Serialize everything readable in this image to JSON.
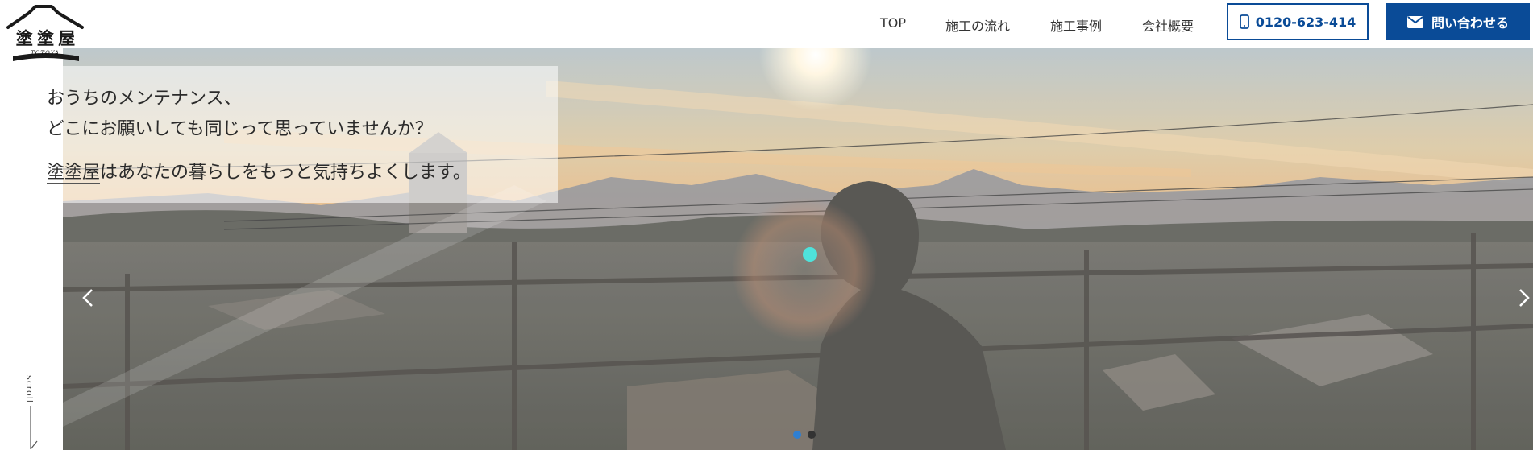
{
  "logo": {
    "text": "塗 塗 屋",
    "sub": "TOTOYA"
  },
  "nav": {
    "items": [
      {
        "label": "TOP"
      },
      {
        "label": "施工の流れ"
      },
      {
        "label": "施工事例"
      },
      {
        "label": "会社概要"
      }
    ],
    "phone_label": "0120-623-414",
    "contact_label": "問い合わせる"
  },
  "hero": {
    "line1": "おうちのメンテナンス、",
    "line2": "どこにお願いしても同じって思っていませんか？",
    "line3_brand": "塗塗屋",
    "line3_rest": "はあなたの暮らしをもっと気持ちよくします。",
    "slide_count": 2,
    "active_slide": 1
  },
  "scroll": {
    "label": "scroll"
  },
  "colors": {
    "brand_blue": "#0a4b97",
    "dot_active": "#2f7fd1",
    "dot_inactive": "#333333"
  },
  "icons": [
    "phone-icon",
    "mail-icon",
    "chevron-left-icon",
    "chevron-right-icon"
  ]
}
